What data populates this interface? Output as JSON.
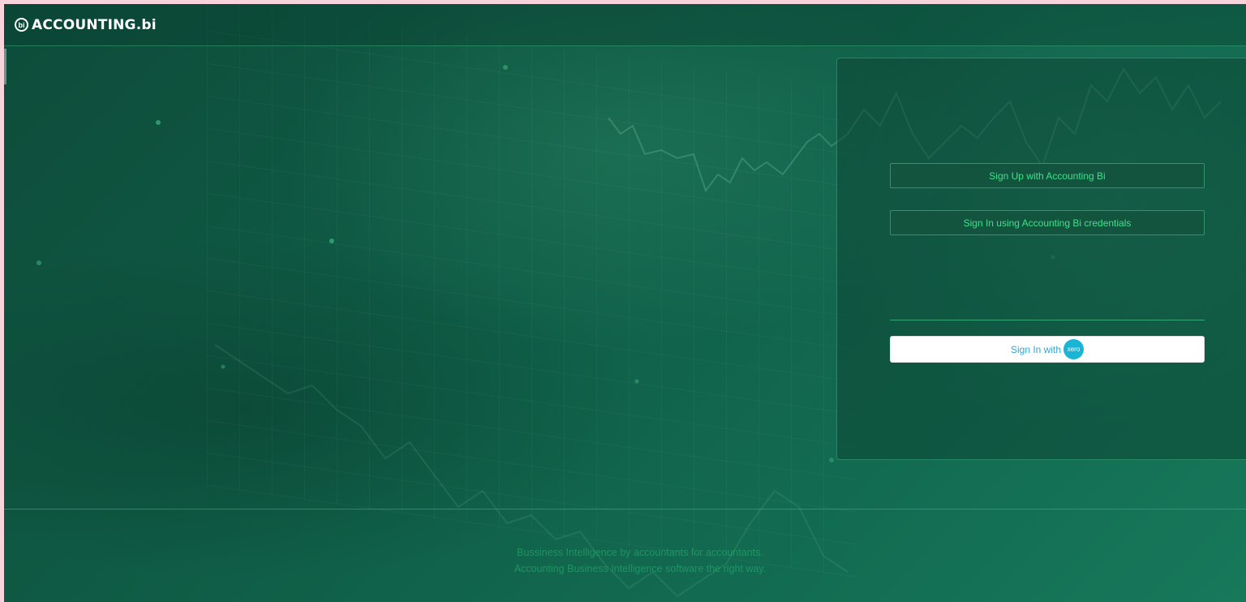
{
  "header": {
    "logo_mark": "bi",
    "logo_text": "ACCOUNTING.bi"
  },
  "login": {
    "signup_label": "Sign Up with Accounting Bi",
    "signin_label": "Sign In using Accounting Bi credentials",
    "xero_label": "Sign In with",
    "xero_badge": "xero"
  },
  "footer": {
    "line1": "Bussiness Intelligence by accountants for accountants.",
    "line2": "Accounting Business Intelligence software the right way."
  },
  "colors": {
    "background": "#0f5a44",
    "accent": "#3ee08c",
    "xero_blue": "#1ab4d7"
  }
}
